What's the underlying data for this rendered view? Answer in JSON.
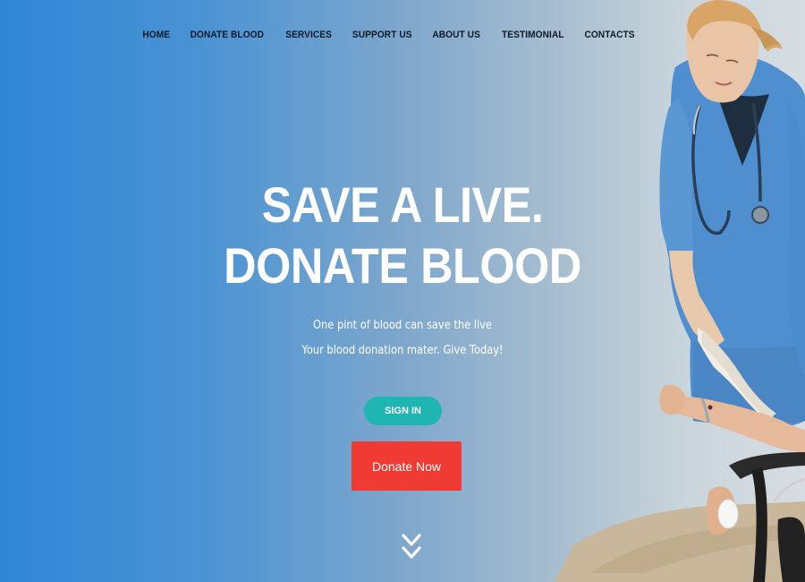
{
  "nav": {
    "items": [
      {
        "label": "HOME"
      },
      {
        "label": "DONATE BLOOD"
      },
      {
        "label": "SERVICES"
      },
      {
        "label": "SUPPORT US"
      },
      {
        "label": "ABOUT US"
      },
      {
        "label": "TESTIMONIAL"
      },
      {
        "label": "CONTACTS"
      }
    ]
  },
  "hero": {
    "headline_line1": "SAVE A LIVE.",
    "headline_line2": "DONATE BLOOD",
    "subtext_line1": "One pint of blood can save the live",
    "subtext_line2": "Your blood donation mater. Give Today!",
    "signin_label": "SIGN IN",
    "donate_label": "Donate Now"
  },
  "icons": {
    "scroll": "double-chevron-down-icon"
  },
  "colors": {
    "gradient_left": "#2f86d6",
    "gradient_right": "#d6dde2",
    "signin_bg": "#1fb6b1",
    "donate_bg": "#ef3b33",
    "nav_text": "#0d1a2a"
  }
}
